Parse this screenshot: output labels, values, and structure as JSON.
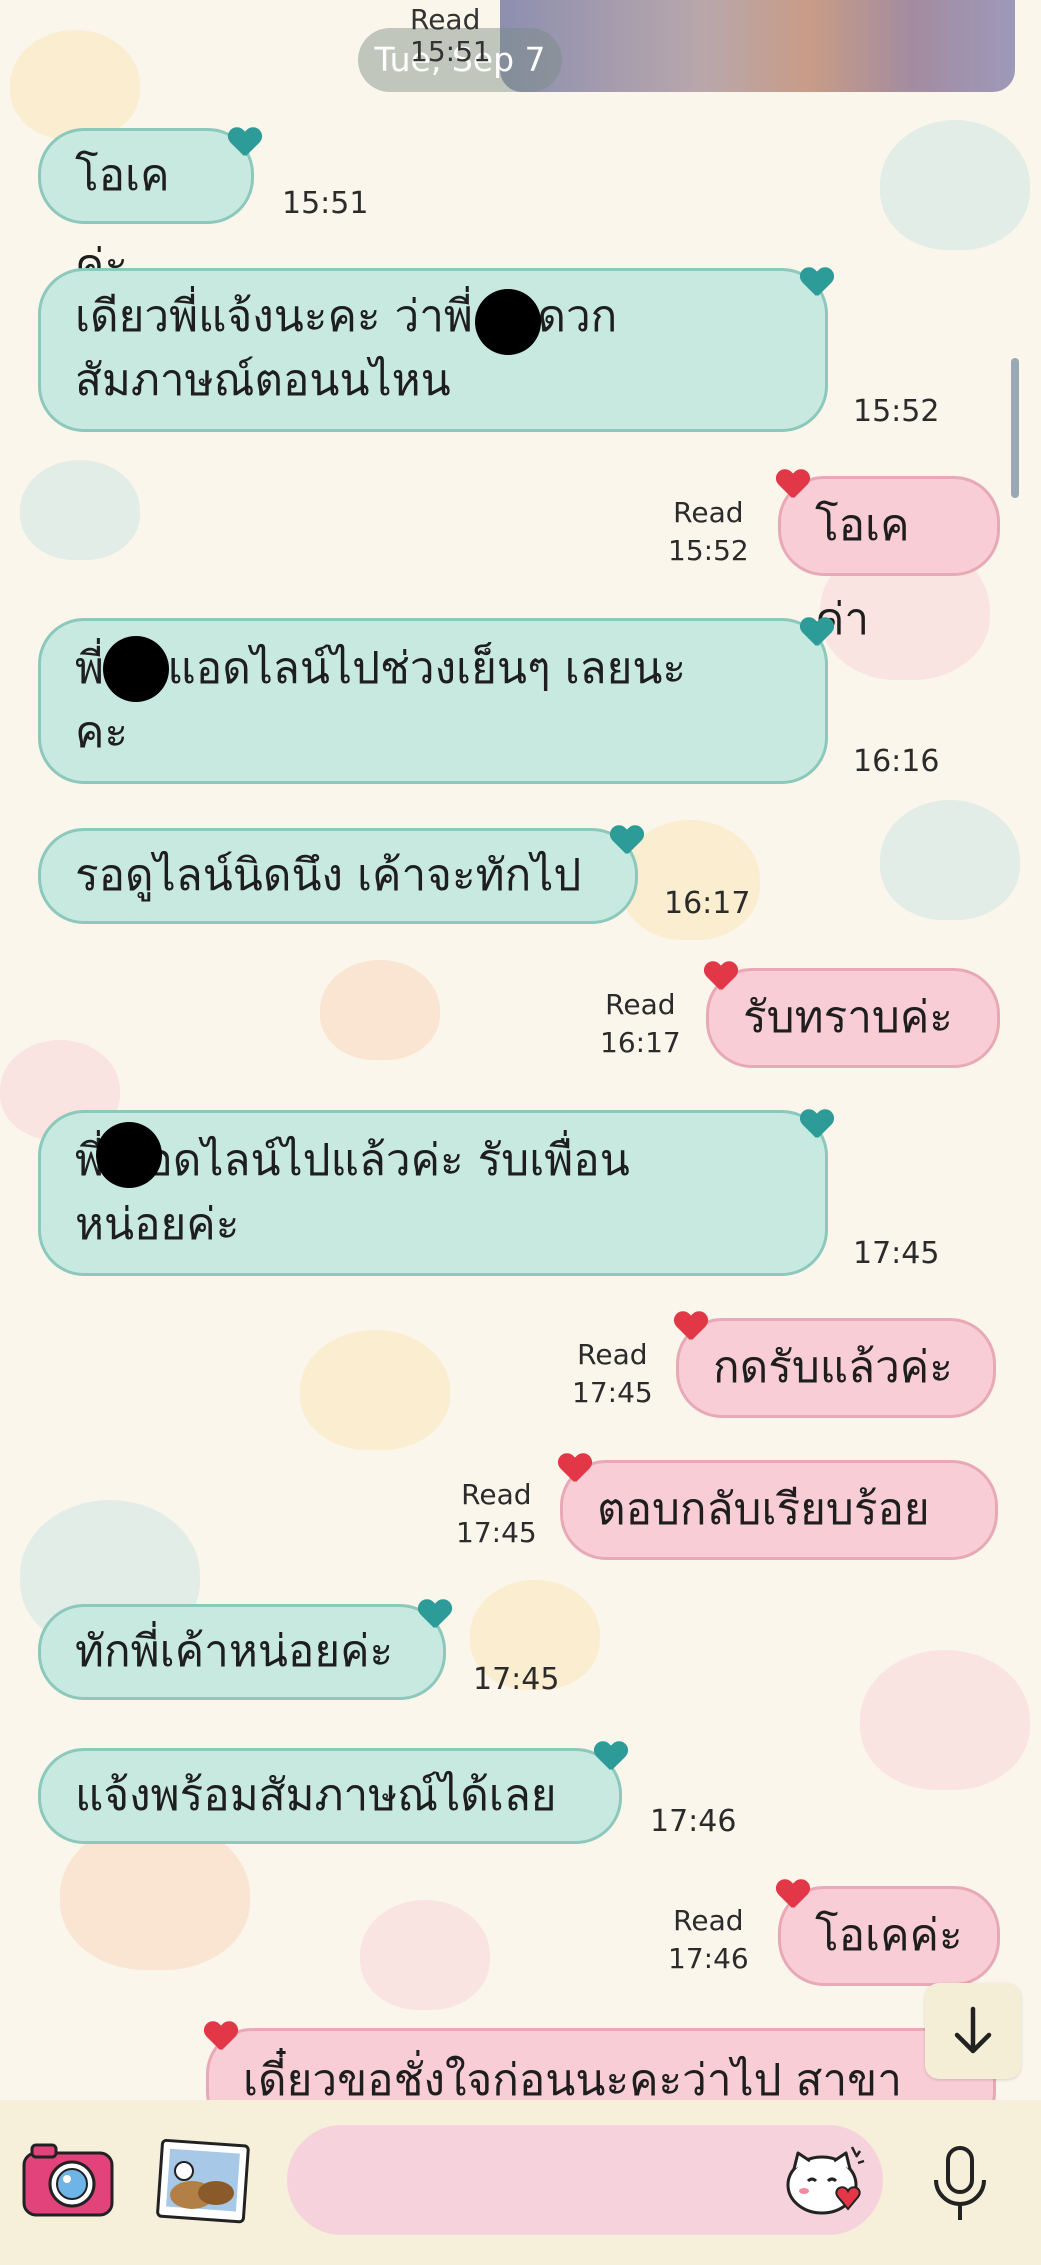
{
  "header": {
    "date_label": "Tue, Sep 7",
    "read_label": "Read",
    "read_time": "15:51"
  },
  "messages": [
    {
      "dir": "in",
      "text": "โอเคค่ะ",
      "time": "15:51"
    },
    {
      "dir": "in",
      "text": "เดียวพี่แจ้งนะคะ ว่าพี่ สะดวก สัมภาษณ์ตอนนไหน",
      "line1": "เดียวพี่แจ้งนะคะ ว่าพี่ สะดวก",
      "line2": "สัมภาษณ์ตอนนไหน",
      "time": "15:52"
    },
    {
      "dir": "out",
      "text": "โอเคค่า",
      "read": "Read",
      "time": "15:52"
    },
    {
      "dir": "in",
      "text": "พี่ จะแอดไลน์ไปช่วงเย็นๆ เลยนะ คะ",
      "line1": "พี่ จะแอดไลน์ไปช่วงเย็นๆ เลยนะ",
      "line2": "คะ",
      "time": "16:16"
    },
    {
      "dir": "in",
      "text": "รอดูไลน์นิดนึง เค้าจะทักไป",
      "time": "16:17"
    },
    {
      "dir": "out",
      "text": "รับทราบค่ะ",
      "read": "Read",
      "time": "16:17"
    },
    {
      "dir": "in",
      "text": "พี่ แอดไลน์ไปแล้วค่ะ รับเพื่อน หน่อยค่ะ",
      "line1": "พี่ แอดไลน์ไปแล้วค่ะ รับเพื่อน",
      "line2": "หน่อยค่ะ",
      "time": "17:45"
    },
    {
      "dir": "out",
      "text": "กดรับแล้วค่ะ",
      "read": "Read",
      "time": "17:45"
    },
    {
      "dir": "out",
      "text": "ตอบกลับเรียบร้อย",
      "read": "Read",
      "time": "17:45"
    },
    {
      "dir": "in",
      "text": "ทักพี่เค้าหน่อยค่ะ",
      "time": "17:45"
    },
    {
      "dir": "in",
      "text": "แจ้งพร้อมสัมภาษณ์ได้เลย",
      "time": "17:46"
    },
    {
      "dir": "out",
      "text": "โอเคค่ะ",
      "read": "Read",
      "time": "17:46"
    },
    {
      "dir": "out",
      "text": "เดี๋ยวขอชั่งใจก่อนนะคะว่าไป สาขา"
    }
  ],
  "input": {
    "placeholder": ""
  },
  "icons": {
    "camera": "camera-icon",
    "gallery": "gallery-icon",
    "sticker": "sticker-icon",
    "mic": "microphone-icon",
    "down": "arrow-down-icon"
  },
  "colors": {
    "incoming_bubble": "#c8e9e0",
    "outgoing_bubble": "#f8cdd6",
    "background": "#fbf6ec",
    "input_bg": "#f6d3dc"
  }
}
